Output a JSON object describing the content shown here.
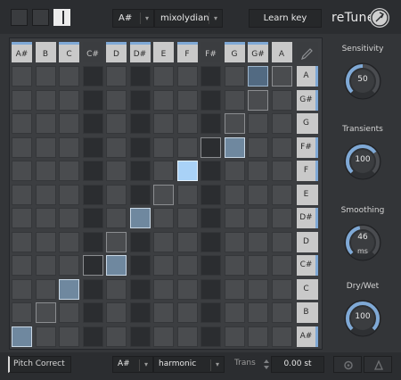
{
  "header": {
    "key": "A#",
    "scale": "mixolydian",
    "learn_key": "Learn key",
    "logo": "reTune",
    "caret": "▾"
  },
  "grid": {
    "columns": [
      {
        "label": "A#",
        "shade": "light",
        "marked": true
      },
      {
        "label": "B",
        "shade": "light",
        "marked": false
      },
      {
        "label": "C",
        "shade": "light",
        "marked": true
      },
      {
        "label": "C#",
        "shade": "dark",
        "marked": false
      },
      {
        "label": "D",
        "shade": "light",
        "marked": true
      },
      {
        "label": "D#",
        "shade": "light",
        "marked": true
      },
      {
        "label": "E",
        "shade": "light",
        "marked": false
      },
      {
        "label": "F",
        "shade": "light",
        "marked": true
      },
      {
        "label": "F#",
        "shade": "dark",
        "marked": false
      },
      {
        "label": "G",
        "shade": "light",
        "marked": true
      },
      {
        "label": "G#",
        "shade": "light",
        "marked": true
      },
      {
        "label": "A",
        "shade": "light",
        "marked": false
      }
    ],
    "rows": [
      {
        "label": "A",
        "shade": "light",
        "marked": true
      },
      {
        "label": "G#",
        "shade": "light",
        "marked": true
      },
      {
        "label": "G",
        "shade": "light",
        "marked": false
      },
      {
        "label": "F#",
        "shade": "light",
        "marked": true
      },
      {
        "label": "F",
        "shade": "light",
        "marked": true
      },
      {
        "label": "E",
        "shade": "light",
        "marked": false
      },
      {
        "label": "D#",
        "shade": "light",
        "marked": true
      },
      {
        "label": "D",
        "shade": "light",
        "marked": false
      },
      {
        "label": "C#",
        "shade": "light",
        "marked": true
      },
      {
        "label": "C",
        "shade": "light",
        "marked": false
      },
      {
        "label": "B",
        "shade": "light",
        "marked": false
      },
      {
        "label": "A#",
        "shade": "light",
        "marked": true
      }
    ],
    "active_cells": [
      {
        "row": 11,
        "col": 0,
        "state": "on"
      },
      {
        "row": 9,
        "col": 2,
        "state": "on"
      },
      {
        "row": 8,
        "col": 4,
        "state": "on"
      },
      {
        "row": 6,
        "col": 5,
        "state": "on"
      },
      {
        "row": 4,
        "col": 7,
        "state": "bright"
      },
      {
        "row": 3,
        "col": 9,
        "state": "on"
      },
      {
        "row": 0,
        "col": 10,
        "state": "hold"
      }
    ],
    "outlined_cells": [
      {
        "row": 10,
        "col": 1
      },
      {
        "row": 8,
        "col": 3
      },
      {
        "row": 7,
        "col": 4
      },
      {
        "row": 5,
        "col": 6
      },
      {
        "row": 3,
        "col": 8
      },
      {
        "row": 2,
        "col": 9
      },
      {
        "row": 1,
        "col": 10
      },
      {
        "row": 0,
        "col": 11
      }
    ],
    "dark_columns": [
      3,
      5,
      8
    ]
  },
  "knobs": [
    {
      "label": "Sensitivity",
      "value": "50",
      "unit": "",
      "level": 0.5
    },
    {
      "label": "Transients",
      "value": "100",
      "unit": "",
      "level": 0.7
    },
    {
      "label": "Smoothing",
      "value": "46",
      "unit": "ms",
      "level": 0.46
    },
    {
      "label": "Dry/Wet",
      "value": "100",
      "unit": "",
      "level": 1.0
    }
  ],
  "footer": {
    "pitch_correct": "Pitch Correct",
    "key": "A#",
    "mode": "harmonic",
    "trans_label": "Trans",
    "trans_value": "0.00 st"
  },
  "colors": {
    "accent": "#7fa9d6",
    "active": "#6f889f",
    "bright": "#a9d2f7"
  }
}
